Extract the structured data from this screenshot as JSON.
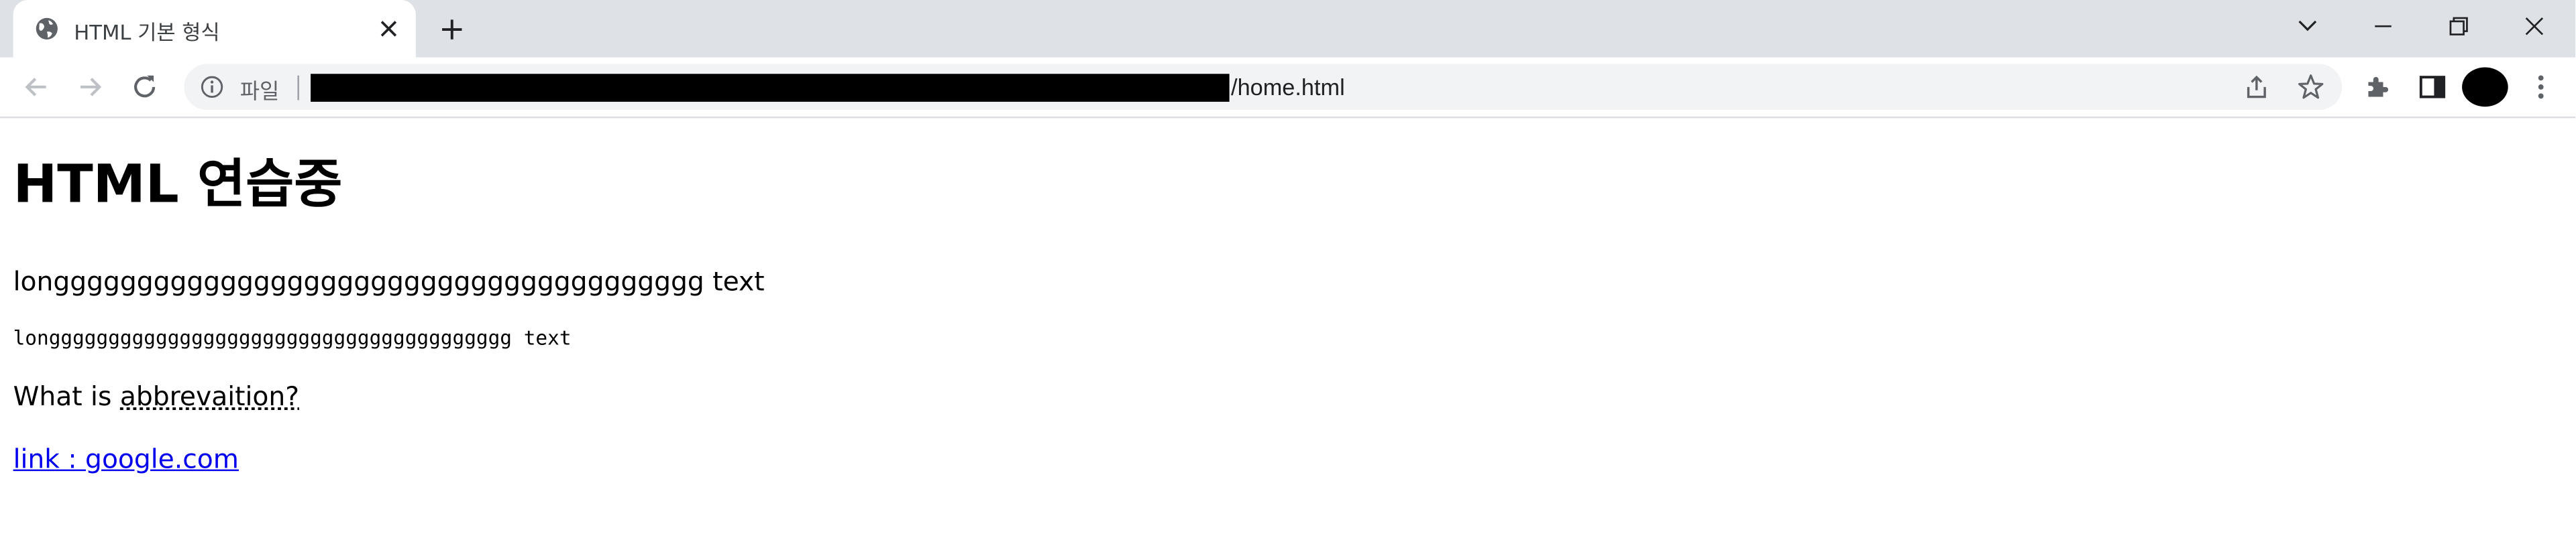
{
  "browser": {
    "tab": {
      "title": "HTML 기본 형식",
      "favicon": "globe-icon"
    },
    "address_bar": {
      "scheme_label": "파일",
      "url_visible_path": "/home.html",
      "url_redacted": true
    },
    "icons": {
      "back": "arrow-back-icon",
      "forward": "arrow-forward-icon",
      "reload": "reload-icon",
      "share": "share-icon",
      "bookmark": "star-icon",
      "extensions": "puzzle-icon",
      "side_panel": "side-panel-icon",
      "menu": "kebab-menu-icon",
      "tab_search": "chevron-down-icon",
      "minimize": "minimize-icon",
      "restore": "restore-icon",
      "close": "close-icon",
      "new_tab": "plus-icon"
    }
  },
  "page": {
    "heading": "HTML 연습중",
    "long_text": "longgggggggggggggggggggggggggggggggggggggg text",
    "mono_text": "longgggggggggggggggggggggggggggggggggggggg text",
    "abbr_prefix": "What is ",
    "abbr_text": "abbrevaition?",
    "link_text": "link : google.com"
  },
  "colors": {
    "tabstrip_bg": "#dee1e6",
    "omnibox_bg": "#f1f3f4",
    "link": "#0000ee"
  }
}
